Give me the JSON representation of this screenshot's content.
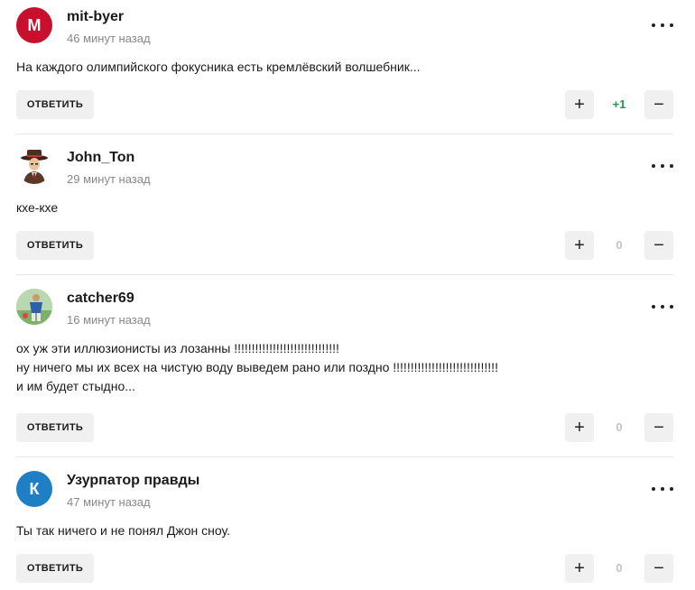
{
  "comments": [
    {
      "author": "mit-byer",
      "time": "46 минут назад",
      "avatar_letter": "M",
      "avatar_color": "#c8102e",
      "lines": [
        "На каждого олимпийского фокусника есть кремлёвский волшебник..."
      ],
      "reply_label": "ОТВЕТИТЬ",
      "score": "+1"
    },
    {
      "author": "John_Ton",
      "time": "29 минут назад",
      "avatar_letter": "",
      "avatar_color": "#ffffff",
      "lines": [
        "кхе-кхе"
      ],
      "reply_label": "ОТВЕТИТЬ",
      "score": "0"
    },
    {
      "author": "catcher69",
      "time": "16 минут назад",
      "avatar_letter": "",
      "avatar_color": "#9fc7a6",
      "lines": [
        "ох уж эти иллюзионисты из лозанны !!!!!!!!!!!!!!!!!!!!!!!!!!!!!!",
        "ну ничего мы их всех на чистую воду выведем рано или поздно !!!!!!!!!!!!!!!!!!!!!!!!!!!!!!",
        "и им будет стыдно..."
      ],
      "reply_label": "ОТВЕТИТЬ",
      "score": "0"
    },
    {
      "author": "Узурпатор правды",
      "time": "47 минут назад",
      "avatar_letter": "К",
      "avatar_color": "#1f7fc4",
      "lines": [
        "Ты так ничего и не понял Джон сноу."
      ],
      "reply_label": "ОТВЕТИТЬ",
      "score": "0"
    }
  ],
  "vote": {
    "plus_symbol": "+",
    "minus_symbol": "−"
  },
  "colors": {
    "score_positive": "#1a9c4b",
    "score_neutral": "#c4c4c4",
    "button_bg": "#f0f0f0"
  }
}
